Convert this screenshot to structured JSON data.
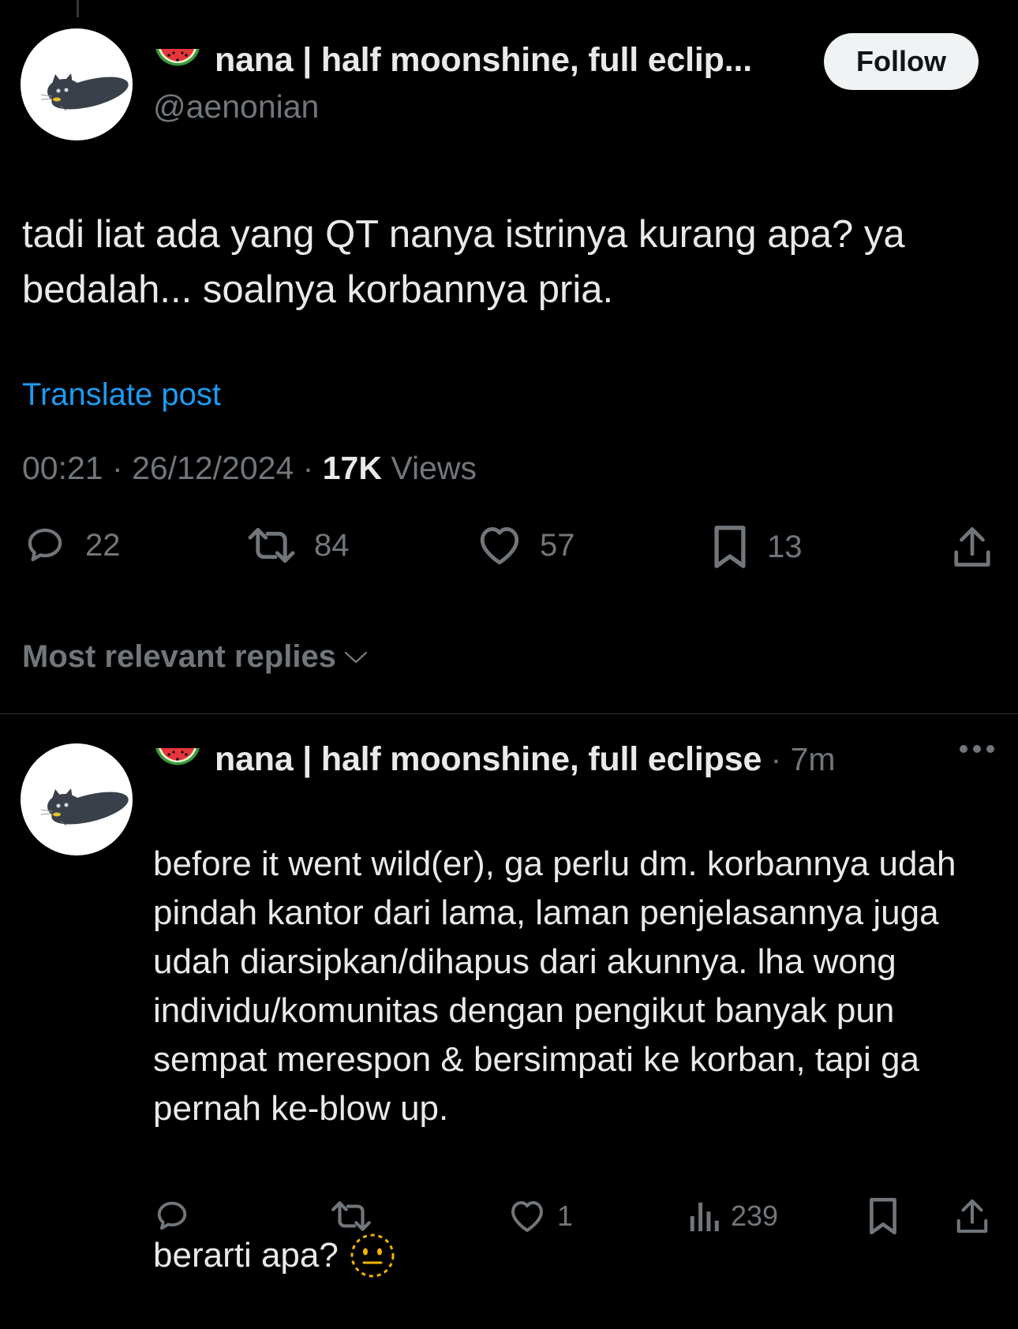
{
  "post": {
    "display_name": "nana | half moonshine, full eclip...",
    "handle": "@aenonian",
    "follow_label": "Follow",
    "text": "tadi liat ada yang QT nanya istrinya kurang apa? ya bedalah... soalnya korbannya pria.",
    "translate_label": "Translate post",
    "time": "00:21",
    "date": "26/12/2024",
    "views_count": "17K",
    "views_label": "Views",
    "replies": "22",
    "reposts": "84",
    "likes": "57",
    "bookmarks": "13"
  },
  "sort_label": "Most relevant replies",
  "reply": {
    "display_name": "nana | half moonshine, full eclipse",
    "time": "7m",
    "text": "before it went wild(er), ga perlu dm. korbannya udah pindah kantor dari lama, laman penjelasannya juga udah diarsipkan/dihapus dari akunnya. lha wong individu/komunitas dengan pengikut banyak pun sempat merespon & bersimpati ke korban, tapi ga pernah ke-blow up.",
    "text2": "berarti apa?",
    "likes": "1",
    "views": "239"
  },
  "icons": {
    "emoji": "watermelon-emoji",
    "reply_emoji": "dotted-line-face-emoji",
    "reply": "reply-icon",
    "repost": "repost-icon",
    "like": "heart-icon",
    "bookmark": "bookmark-icon",
    "share": "share-icon",
    "views": "views-icon",
    "more": "more-icon"
  },
  "colors": {
    "background": "#000000",
    "text": "#e7e9ea",
    "muted": "#71767b",
    "link": "#1d9bf0",
    "follow_bg": "#eff3f4"
  }
}
